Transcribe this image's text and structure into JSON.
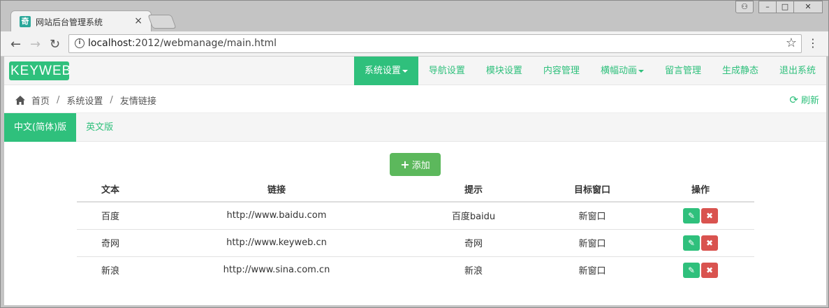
{
  "browser": {
    "tab_title": "网站后台管理系统",
    "tab_close": "×",
    "url_host": "localhost",
    "url_path": ":2012/webmanage/main.html",
    "back_glyph": "←",
    "forward_glyph": "→",
    "reload_glyph": "↻",
    "star_glyph": "☆",
    "menu_glyph": "⋮",
    "info_glyph": "i",
    "win_profile": "⚇",
    "win_min": "–",
    "win_max": "□",
    "win_close": "✕"
  },
  "header": {
    "logo": "KEYWEB",
    "nav": [
      {
        "label": "系统设置",
        "dropdown": true,
        "active": true
      },
      {
        "label": "导航设置"
      },
      {
        "label": "模块设置"
      },
      {
        "label": "内容管理"
      },
      {
        "label": "横幅动画",
        "dropdown": true
      },
      {
        "label": "留言管理"
      },
      {
        "label": "生成静态"
      },
      {
        "label": "退出系统"
      }
    ]
  },
  "breadcrumb": {
    "items": [
      "首页",
      "系统设置",
      "友情链接"
    ],
    "separator": "/",
    "refresh_label": "刷新",
    "refresh_glyph": "⟳"
  },
  "lang_tabs": [
    "中文(简体)版",
    "英文版"
  ],
  "add_button": {
    "label": "添加",
    "icon": "+"
  },
  "table": {
    "columns": [
      "文本",
      "链接",
      "提示",
      "目标窗口",
      "操作"
    ],
    "rows": [
      {
        "text": "百度",
        "link": "http://www.baidu.com",
        "hint": "百度baidu",
        "target": "新窗口"
      },
      {
        "text": "奇网",
        "link": "http://www.keyweb.cn",
        "hint": "奇网",
        "target": "新窗口"
      },
      {
        "text": "新浪",
        "link": "http://www.sina.com.cn",
        "hint": "新浪",
        "target": "新窗口"
      }
    ],
    "edit_glyph": "✎",
    "delete_glyph": "✖"
  },
  "colors": {
    "accent": "#2fc07c",
    "add": "#5cb85c",
    "danger": "#d9534f"
  }
}
